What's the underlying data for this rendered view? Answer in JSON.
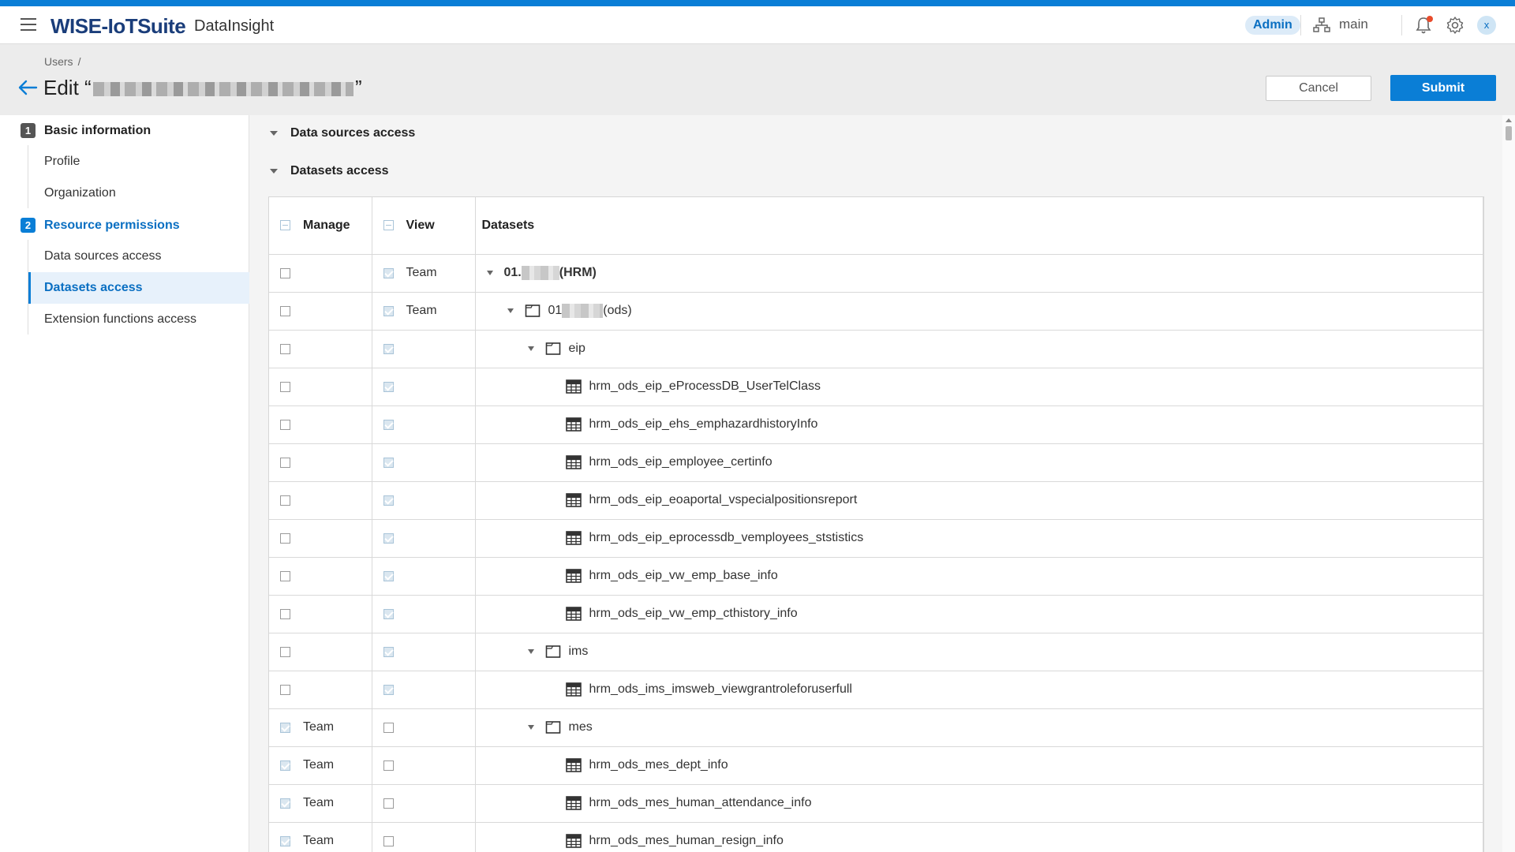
{
  "app": {
    "brand": "WISE-IoTSuite",
    "product": "DataInsight",
    "role_badge": "Admin",
    "workspace": "main",
    "avatar_initial": "x"
  },
  "page": {
    "breadcrumb": [
      "Users",
      "/"
    ],
    "title_prefix": "Edit “",
    "title_suffix": "”",
    "cancel_label": "Cancel",
    "submit_label": "Submit"
  },
  "sidenav": {
    "steps": [
      {
        "num": "1",
        "label": "Basic information",
        "items": [
          "Profile",
          "Organization"
        ]
      },
      {
        "num": "2",
        "label": "Resource permissions",
        "items": [
          "Data sources access",
          "Datasets access",
          "Extension functions access"
        ]
      }
    ],
    "active_item": "Datasets access"
  },
  "sections": {
    "data_sources": "Data sources access",
    "datasets": "Datasets access"
  },
  "table": {
    "headers": {
      "manage": "Manage",
      "view": "View",
      "datasets": "Datasets"
    },
    "rows": [
      {
        "manage_checked": false,
        "manage_label": "",
        "view_checked": true,
        "view_label": "Team",
        "type": "root",
        "depth": 0,
        "name_prefix": "01.",
        "name_suffix": "(HRM)"
      },
      {
        "manage_checked": false,
        "manage_label": "",
        "view_checked": true,
        "view_label": "Team",
        "type": "folder",
        "depth": 1,
        "name_prefix": "01",
        "name_suffix": "(ods)"
      },
      {
        "manage_checked": false,
        "manage_label": "",
        "view_checked": true,
        "view_label": "",
        "type": "folder",
        "depth": 2,
        "name_prefix": "eip",
        "name_suffix": ""
      },
      {
        "manage_checked": false,
        "manage_label": "",
        "view_checked": true,
        "view_label": "",
        "type": "table",
        "depth": 3,
        "name_prefix": "hrm_ods_eip_eProcessDB_UserTelClass",
        "name_suffix": ""
      },
      {
        "manage_checked": false,
        "manage_label": "",
        "view_checked": true,
        "view_label": "",
        "type": "table",
        "depth": 3,
        "name_prefix": "hrm_ods_eip_ehs_emphazardhistoryInfo",
        "name_suffix": ""
      },
      {
        "manage_checked": false,
        "manage_label": "",
        "view_checked": true,
        "view_label": "",
        "type": "table",
        "depth": 3,
        "name_prefix": "hrm_ods_eip_employee_certinfo",
        "name_suffix": ""
      },
      {
        "manage_checked": false,
        "manage_label": "",
        "view_checked": true,
        "view_label": "",
        "type": "table",
        "depth": 3,
        "name_prefix": "hrm_ods_eip_eoaportal_vspecialpositionsreport",
        "name_suffix": ""
      },
      {
        "manage_checked": false,
        "manage_label": "",
        "view_checked": true,
        "view_label": "",
        "type": "table",
        "depth": 3,
        "name_prefix": "hrm_ods_eip_eprocessdb_vemployees_ststistics",
        "name_suffix": ""
      },
      {
        "manage_checked": false,
        "manage_label": "",
        "view_checked": true,
        "view_label": "",
        "type": "table",
        "depth": 3,
        "name_prefix": "hrm_ods_eip_vw_emp_base_info",
        "name_suffix": ""
      },
      {
        "manage_checked": false,
        "manage_label": "",
        "view_checked": true,
        "view_label": "",
        "type": "table",
        "depth": 3,
        "name_prefix": "hrm_ods_eip_vw_emp_cthistory_info",
        "name_suffix": ""
      },
      {
        "manage_checked": false,
        "manage_label": "",
        "view_checked": true,
        "view_label": "",
        "type": "folder",
        "depth": 2,
        "name_prefix": "ims",
        "name_suffix": ""
      },
      {
        "manage_checked": false,
        "manage_label": "",
        "view_checked": true,
        "view_label": "",
        "type": "table",
        "depth": 3,
        "name_prefix": "hrm_ods_ims_imsweb_viewgrantroleforuserfull",
        "name_suffix": ""
      },
      {
        "manage_checked": true,
        "manage_label": "Team",
        "view_checked": false,
        "view_label": "",
        "type": "folder",
        "depth": 2,
        "name_prefix": "mes",
        "name_suffix": ""
      },
      {
        "manage_checked": true,
        "manage_label": "Team",
        "view_checked": false,
        "view_label": "",
        "type": "table",
        "depth": 3,
        "name_prefix": "hrm_ods_mes_dept_info",
        "name_suffix": ""
      },
      {
        "manage_checked": true,
        "manage_label": "Team",
        "view_checked": false,
        "view_label": "",
        "type": "table",
        "depth": 3,
        "name_prefix": "hrm_ods_mes_human_attendance_info",
        "name_suffix": ""
      },
      {
        "manage_checked": true,
        "manage_label": "Team",
        "view_checked": false,
        "view_label": "",
        "type": "table",
        "depth": 3,
        "name_prefix": "hrm_ods_mes_human_resign_info",
        "name_suffix": ""
      }
    ]
  },
  "colors": {
    "accent": "#0a7ed6",
    "brand": "#1a3d7a",
    "active_bg": "#e7f1fb"
  },
  "icons": {
    "menu": "hamburger-icon",
    "back": "arrow-left-icon",
    "org": "org-tree-icon",
    "notifications": "bell-icon",
    "settings": "gear-icon",
    "folder": "folder-icon",
    "table": "table-grid-icon"
  }
}
